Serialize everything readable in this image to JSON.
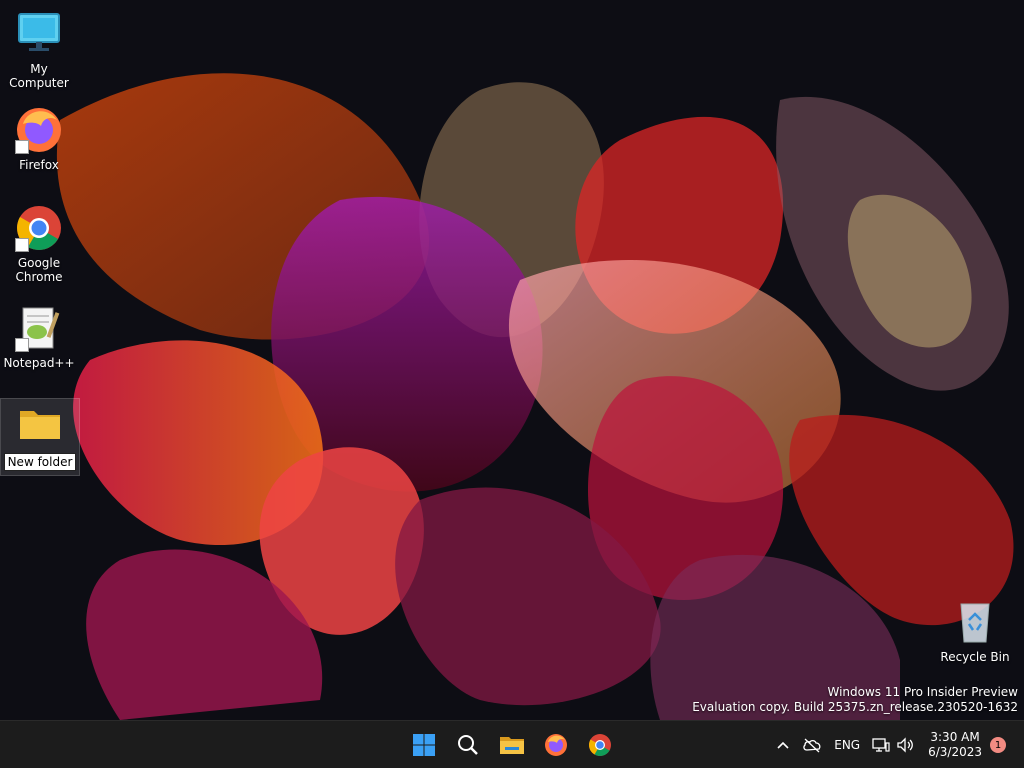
{
  "desktop": {
    "icons": [
      {
        "label": "My Computer",
        "icon": "monitor-icon"
      },
      {
        "label": "Firefox",
        "icon": "firefox-icon",
        "shortcut": true
      },
      {
        "label": "Google Chrome",
        "icon": "chrome-icon",
        "shortcut": true
      },
      {
        "label": "Notepad++",
        "icon": "notepadpp-icon",
        "shortcut": true
      },
      {
        "label": "New folder",
        "icon": "folder-icon",
        "renaming": true
      }
    ],
    "recycle_bin": {
      "label": "Recycle Bin",
      "icon": "recycle-bin-icon"
    }
  },
  "watermark": {
    "line1": "Windows 11 Pro Insider Preview",
    "line2": "Evaluation copy. Build 25375.zn_release.230520-1632"
  },
  "taskbar": {
    "apps": [
      {
        "name": "start",
        "icon": "windows-start-icon"
      },
      {
        "name": "search",
        "icon": "search-icon"
      },
      {
        "name": "file-explorer",
        "icon": "file-explorer-icon"
      },
      {
        "name": "firefox",
        "icon": "firefox-icon"
      },
      {
        "name": "chrome",
        "icon": "chrome-icon"
      }
    ],
    "tray": {
      "language": "ENG",
      "time": "3:30 AM",
      "date": "6/3/2023",
      "notification_count": "1"
    }
  },
  "colors": {
    "taskbar_bg": "#1c1c1c",
    "start_blue": "#3aa0f5",
    "folder_yellow": "#f4c542",
    "notification_badge": "#f28b82"
  }
}
